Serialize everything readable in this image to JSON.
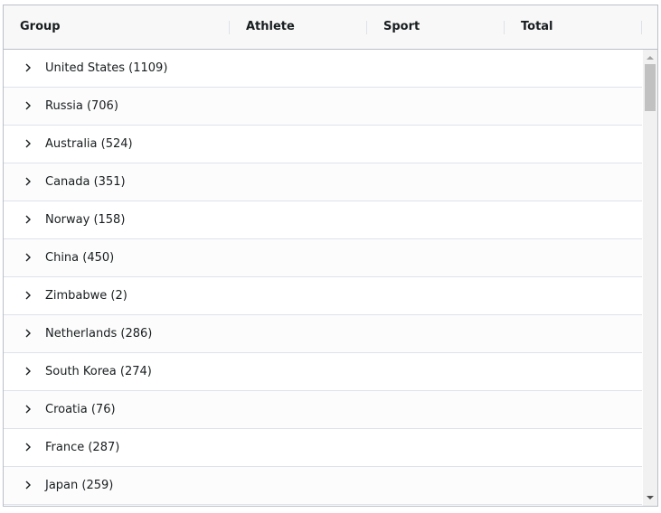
{
  "header": {
    "columns": [
      {
        "label": "Group"
      },
      {
        "label": "Athlete"
      },
      {
        "label": "Sport"
      },
      {
        "label": "Total"
      }
    ]
  },
  "rows": [
    {
      "label": "United States (1109)"
    },
    {
      "label": "Russia (706)"
    },
    {
      "label": "Australia (524)"
    },
    {
      "label": "Canada (351)"
    },
    {
      "label": "Norway (158)"
    },
    {
      "label": "China (450)"
    },
    {
      "label": "Zimbabwe (2)"
    },
    {
      "label": "Netherlands (286)"
    },
    {
      "label": "South Korea (274)"
    },
    {
      "label": "Croatia (76)"
    },
    {
      "label": "France (287)"
    },
    {
      "label": "Japan (259)"
    }
  ],
  "icons": {
    "expand": "chevron-right-icon",
    "scroll_up": "scroll-up-arrow-icon",
    "scroll_down": "scroll-down-arrow-icon"
  },
  "colors": {
    "border": "#babfc7",
    "row_border": "#dde2eb",
    "header_bg": "#f8f8f8",
    "text": "#181d1f"
  }
}
